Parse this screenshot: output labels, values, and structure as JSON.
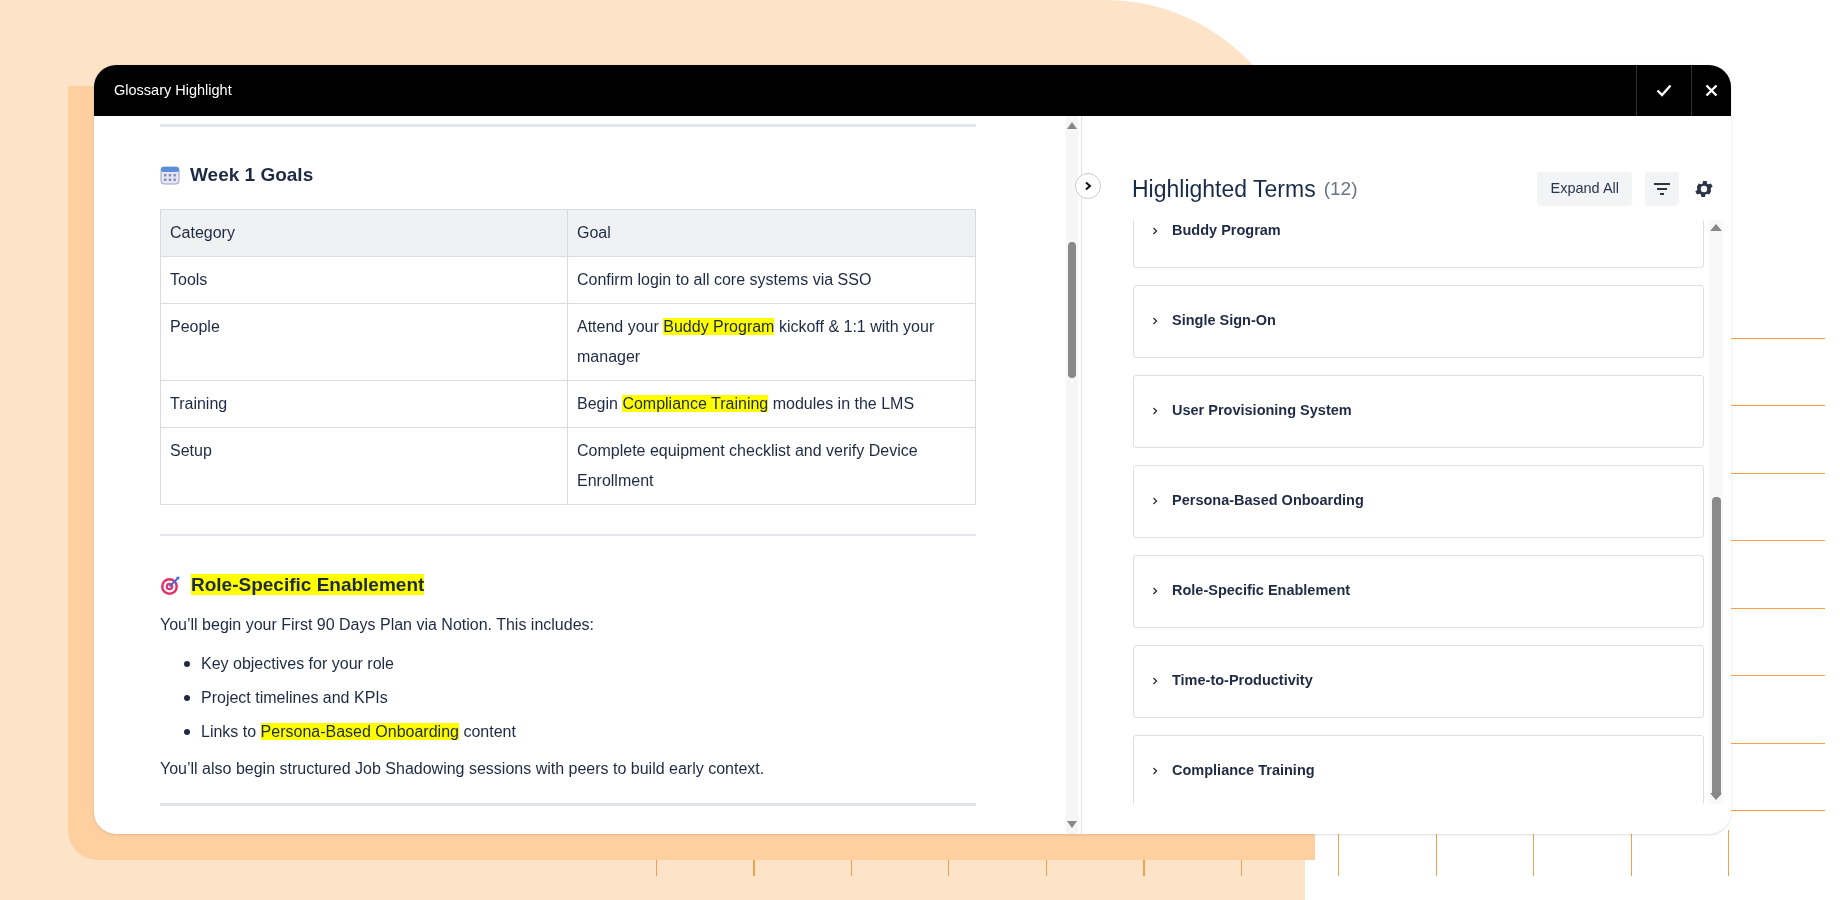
{
  "window": {
    "title": "Glossary Highlight",
    "buttons": [
      {
        "kind": "confirm"
      },
      {
        "kind": "close"
      }
    ]
  },
  "document": {
    "sections": [
      {
        "kind": "calendar",
        "heading": [
          {
            "text": "Week 1 Goals",
            "highlighted": false
          }
        ],
        "table": {
          "columns": [
            "Category",
            "Goal"
          ],
          "rows": [
            {
              "category": "Tools",
              "goal": [
                {
                  "text": "Confirm login to all core systems via SSO",
                  "highlighted": false
                }
              ]
            },
            {
              "category": "People",
              "goal": [
                {
                  "text": "Attend your ",
                  "highlighted": false
                },
                {
                  "text": "Buddy Program",
                  "highlighted": true
                },
                {
                  "text": " kickoff & 1:1 with your manager",
                  "highlighted": false
                }
              ]
            },
            {
              "category": "Training",
              "goal": [
                {
                  "text": "Begin ",
                  "highlighted": false
                },
                {
                  "text": "Compliance Training",
                  "highlighted": true
                },
                {
                  "text": " modules in the LMS",
                  "highlighted": false
                }
              ]
            },
            {
              "category": "Setup",
              "goal": [
                {
                  "text": "Complete equipment checklist and verify Device Enrollment",
                  "highlighted": false
                }
              ]
            }
          ]
        }
      },
      {
        "kind": "target",
        "heading": [
          {
            "text": "Role-Specific Enablement",
            "highlighted": true
          }
        ],
        "intro": [
          {
            "text": "You’ll begin your First 90 Days Plan via Notion. This includes:",
            "highlighted": false
          }
        ],
        "bullets": [
          [
            {
              "text": "Key objectives for your role",
              "highlighted": false
            }
          ],
          [
            {
              "text": "Project timelines and KPIs",
              "highlighted": false
            }
          ],
          [
            {
              "text": "Links to ",
              "highlighted": false
            },
            {
              "text": "Persona-Based Onboarding",
              "highlighted": true
            },
            {
              "text": " content",
              "highlighted": false
            }
          ]
        ],
        "outro": [
          {
            "text": "You’ll also begin structured Job Shadowing sessions with peers to build early context.",
            "highlighted": false
          }
        ]
      }
    ]
  },
  "panel": {
    "title": "Highlighted Terms",
    "count": "(12)",
    "expand_button": "Expand All",
    "terms": [
      {
        "label": "Buddy Program",
        "expanded": false
      },
      {
        "label": "Single Sign-On",
        "expanded": false
      },
      {
        "label": "User Provisioning System",
        "expanded": false
      },
      {
        "label": "Persona-Based Onboarding",
        "expanded": false
      },
      {
        "label": "Role-Specific Enablement",
        "expanded": false
      },
      {
        "label": "Time-to-Productivity",
        "expanded": false
      },
      {
        "label": "Compliance Training",
        "expanded": false
      }
    ]
  }
}
